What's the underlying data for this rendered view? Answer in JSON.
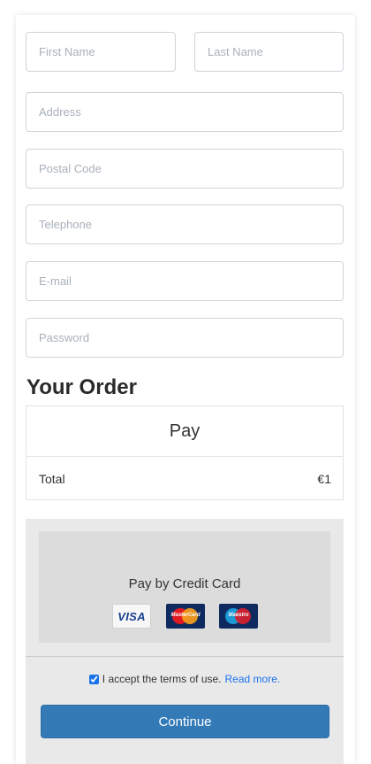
{
  "form": {
    "first_name": {
      "placeholder": "First Name",
      "value": ""
    },
    "last_name": {
      "placeholder": "Last Name",
      "value": ""
    },
    "address": {
      "placeholder": "Address",
      "value": ""
    },
    "postal_code": {
      "placeholder": "Postal Code",
      "value": ""
    },
    "telephone": {
      "placeholder": "Telephone",
      "value": ""
    },
    "email": {
      "placeholder": "E-mail",
      "value": ""
    },
    "password": {
      "placeholder": "Password",
      "value": ""
    }
  },
  "order": {
    "title": "Your Order",
    "header": "Pay",
    "total_label": "Total",
    "total_value": "€1"
  },
  "payment": {
    "title": "Pay by Credit Card",
    "cards": {
      "visa": "VISA",
      "mastercard": "MasterCard",
      "maestro": "Maestro"
    },
    "terms_text": "I accept the terms of use.",
    "terms_link": "Read more.",
    "terms_checked": true,
    "continue_label": "Continue"
  },
  "colors": {
    "primary_button": "#337ab7",
    "link": "#1a73e8",
    "payment_bg": "#e9e9ea"
  }
}
